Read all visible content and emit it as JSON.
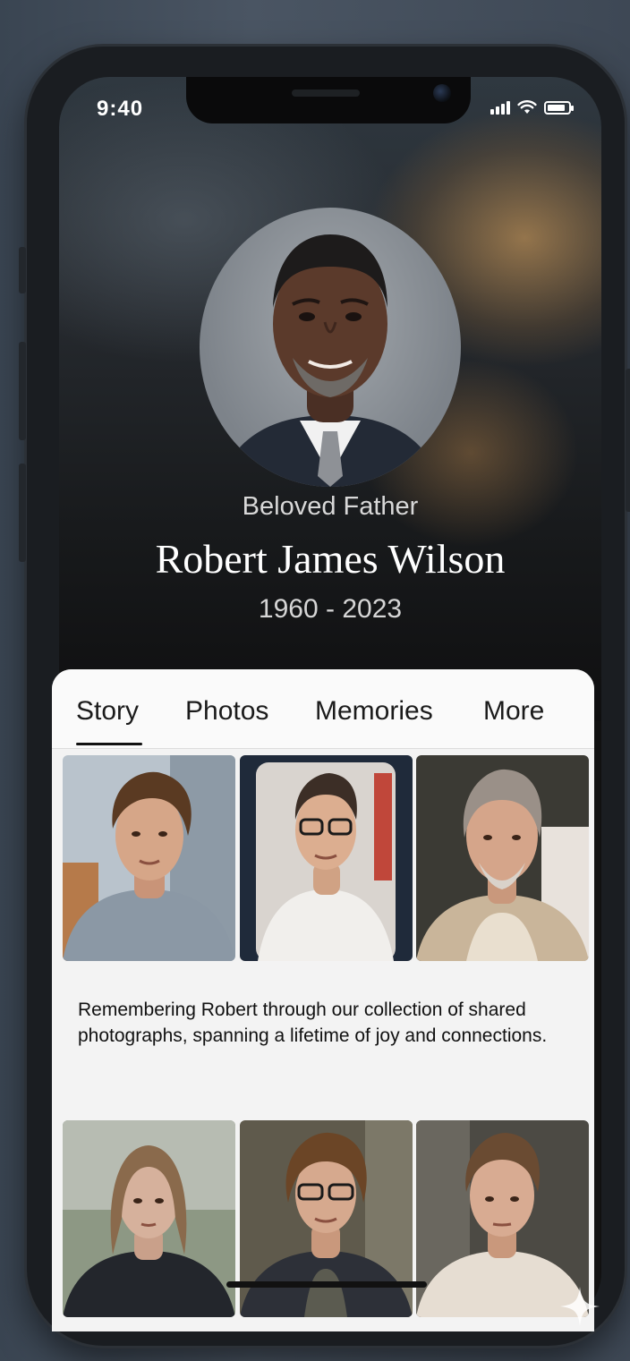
{
  "status_bar": {
    "time": "9:40",
    "signal_icon": "cellular-signal-icon",
    "wifi_icon": "wifi-icon",
    "battery_icon": "battery-icon",
    "battery_level": 0.85
  },
  "hero": {
    "subtitle": "Beloved Father",
    "name": "Robert James Wilson",
    "dates": "1960 - 2023"
  },
  "tabs": [
    {
      "label": "Story",
      "active": true
    },
    {
      "label": "Photos",
      "active": false
    },
    {
      "label": "Memories",
      "active": false
    },
    {
      "label": "More",
      "active": false
    }
  ],
  "gallery": {
    "caption": "Remembering Robert through our collection of shared photographs, spanning a lifetime of joy and connections."
  },
  "colors": {
    "sheet_bg": "#f3f3f3",
    "text_primary": "#111111",
    "hero_accent": "#b88c54"
  }
}
